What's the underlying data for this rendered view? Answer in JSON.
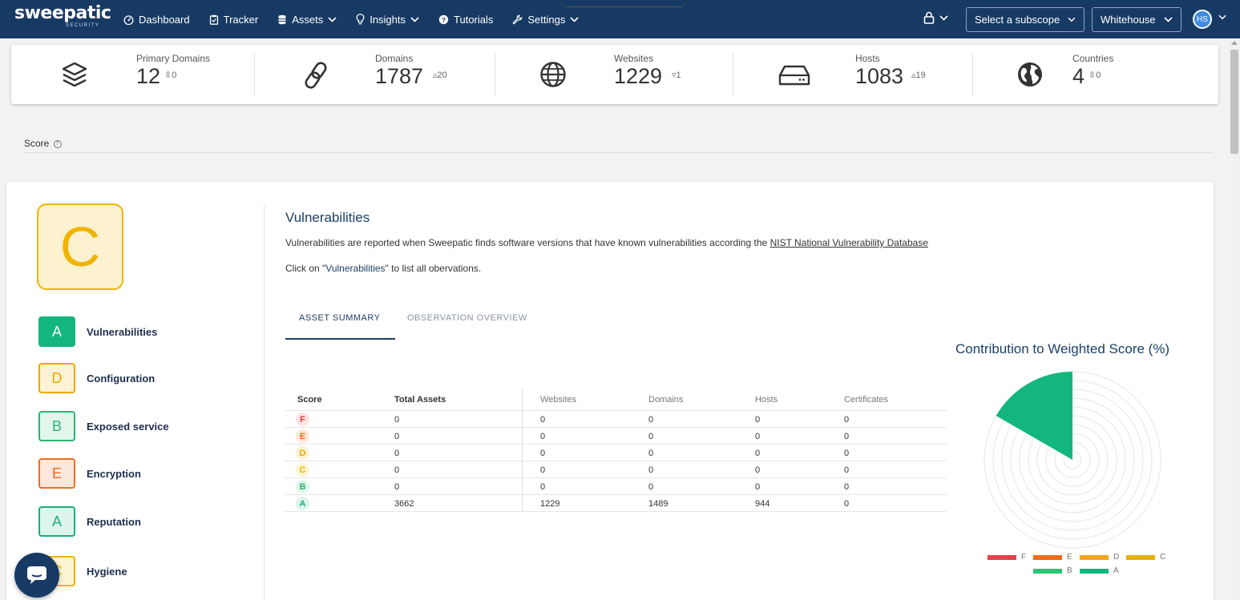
{
  "brand": {
    "name": "sweepatic",
    "sub": "SECURITY"
  },
  "nav": {
    "items": [
      {
        "label": "Dashboard",
        "icon": "dashboard-icon",
        "dropdown": false
      },
      {
        "label": "Tracker",
        "icon": "clipboard-icon",
        "dropdown": false
      },
      {
        "label": "Assets",
        "icon": "database-icon",
        "dropdown": true
      },
      {
        "label": "Insights",
        "icon": "lightbulb-icon",
        "dropdown": true
      },
      {
        "label": "Tutorials",
        "icon": "help-circle-icon",
        "dropdown": false
      },
      {
        "label": "Settings",
        "icon": "wrench-icon",
        "dropdown": true
      }
    ],
    "subscope": "Select a subscope",
    "organization": "Whitehouse",
    "user_initials": "HS"
  },
  "stats": [
    {
      "label": "Primary Domains",
      "value": "12",
      "delta": "0",
      "trend": "neutral",
      "icon": "layers-icon"
    },
    {
      "label": "Domains",
      "value": "1787",
      "delta": "20",
      "trend": "up",
      "icon": "link-icon"
    },
    {
      "label": "Websites",
      "value": "1229",
      "delta": "1",
      "trend": "down",
      "icon": "globe-icon"
    },
    {
      "label": "Hosts",
      "value": "1083",
      "delta": "19",
      "trend": "up",
      "icon": "server-icon"
    },
    {
      "label": "Countries",
      "value": "4",
      "delta": "0",
      "trend": "neutral",
      "icon": "earth-icon"
    }
  ],
  "score_heading": "Score",
  "overall_grade": "C",
  "categories": [
    {
      "grade": "A",
      "name": "Vulnerabilities",
      "selected": true
    },
    {
      "grade": "D",
      "name": "Configuration",
      "selected": false
    },
    {
      "grade": "B",
      "name": "Exposed service",
      "selected": false
    },
    {
      "grade": "E",
      "name": "Encryption",
      "selected": false
    },
    {
      "grade": "A",
      "name": "Reputation",
      "selected": false
    },
    {
      "grade": "C",
      "name": "Hygiene",
      "selected": false
    }
  ],
  "grade_colors": {
    "F": {
      "fg": "#e53935",
      "bg": "#fde4e4",
      "solid": "#e5404a"
    },
    "E": {
      "fg": "#ef6c1a",
      "bg": "#fde8dc",
      "solid": "#ef6c1a"
    },
    "D": {
      "fg": "#f0a500",
      "bg": "#fdf1d6",
      "solid": "#f4a71c"
    },
    "C": {
      "fg": "#f0b400",
      "bg": "#fdf4d2",
      "solid": "#e8b100"
    },
    "B": {
      "fg": "#2bb673",
      "bg": "#e2f6ec",
      "solid": "#31c274"
    },
    "A": {
      "fg": "#16b07a",
      "bg": "#def5ec",
      "solid": "#13b67c"
    }
  },
  "detail": {
    "title": "Vulnerabilities",
    "description_prefix": "Vulnerabilities are reported when Sweepatic finds software versions that have known vulnerabilities according the ",
    "description_link": "NIST National Vulnerability Database",
    "click_prefix": "Click on \"",
    "click_keyword": "Vulnerabilities",
    "click_suffix": "\" to list all obervations.",
    "tabs": [
      {
        "label": "ASSET SUMMARY",
        "active": true
      },
      {
        "label": "OBSERVATION OVERVIEW",
        "active": false
      }
    ]
  },
  "table": {
    "columns": [
      "Score",
      "Total Assets",
      "Websites",
      "Domains",
      "Hosts",
      "Certificates"
    ],
    "rows": [
      [
        "F",
        "0",
        "0",
        "0",
        "0",
        "0"
      ],
      [
        "E",
        "0",
        "0",
        "0",
        "0",
        "0"
      ],
      [
        "D",
        "0",
        "0",
        "0",
        "0",
        "0"
      ],
      [
        "C",
        "0",
        "0",
        "0",
        "0",
        "0"
      ],
      [
        "B",
        "0",
        "0",
        "0",
        "0",
        "0"
      ],
      [
        "A",
        "3662",
        "1229",
        "1489",
        "944",
        "0"
      ]
    ]
  },
  "chart_data": {
    "type": "polar-area",
    "title": "Contribution to Weighted Score (%)",
    "rings": 10,
    "categories": [
      "F",
      "E",
      "D",
      "C",
      "B",
      "A"
    ],
    "segments": [
      {
        "label": "A",
        "value": 100,
        "start_deg": 0,
        "end_deg": 60
      }
    ],
    "legend": [
      "F",
      "E",
      "D",
      "C",
      "B",
      "A"
    ]
  }
}
